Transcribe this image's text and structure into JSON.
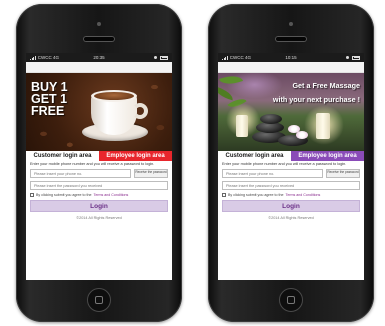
{
  "colors": {
    "tab_red": "#e8262c",
    "tab_purple": "#8a4bb8",
    "login_button_bg": "#d9cbe6",
    "login_button_text": "#6a2f87"
  },
  "phones": [
    {
      "status": {
        "carrier": "CWCC 4G",
        "time": "20:35"
      },
      "promo": {
        "line1": "BUY 1",
        "line2": "GET 1",
        "line3": "FREE"
      },
      "tabs": {
        "customer": "Customer login area",
        "employee": "Employee login area",
        "employee_color": "#e8262c"
      },
      "form": {
        "instructions": "Enter your mobile phone number and you will receive a password to login.",
        "phone_placeholder": "Please insert your phone no.",
        "receive_label": "Receive the password",
        "password_placeholder": "Please insert the password you received",
        "terms_prefix": "By clicking submit you agree to the",
        "terms_link": "Terms and Conditions",
        "login_label": "Login",
        "footer": "©2014 All Rights Reserved"
      }
    },
    {
      "status": {
        "carrier": "CWCC 4G",
        "time": "10:15"
      },
      "promo": {
        "line1": "Get a Free Massage",
        "line2": "with your next purchase !"
      },
      "tabs": {
        "customer": "Customer login area",
        "employee": "Employee login area",
        "employee_color": "#8a4bb8"
      },
      "form": {
        "instructions": "Enter your mobile phone number and you will receive a password to login.",
        "phone_placeholder": "Please insert your phone no.",
        "receive_label": "Receive the password",
        "password_placeholder": "Please insert the password you received",
        "terms_prefix": "By clicking submit you agree to the",
        "terms_link": "Terms and Conditions",
        "login_label": "Login",
        "footer": "©2014 All Rights Reserved"
      }
    }
  ]
}
